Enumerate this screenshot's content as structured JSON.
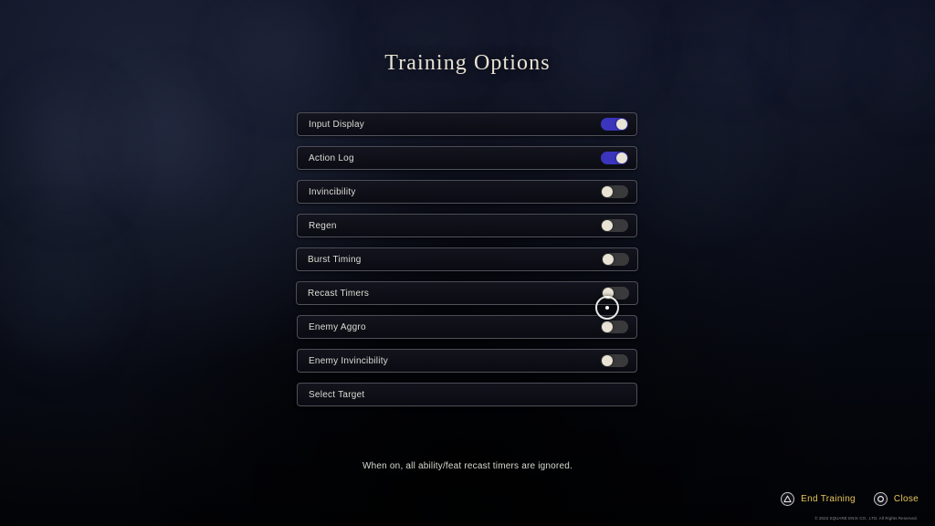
{
  "screen": {
    "title": "Training Options",
    "description": "When on, all ability/feat recast timers are ignored.",
    "copyright": "© 2023 SQUARE ENIX CO., LTD. All Rights Reserved."
  },
  "colors": {
    "toggle_on": "#3b35bd",
    "toggle_off": "#3a3a3c",
    "knob": "#e8e3d4",
    "title_text": "#e9e3d4",
    "label_text": "#ddddd6",
    "prompt_text": "#e8c65c",
    "row_border": "#a8aab6"
  },
  "options": [
    {
      "label": "Input Display",
      "has_toggle": true,
      "state": "on",
      "selected": false
    },
    {
      "label": "Action Log",
      "has_toggle": true,
      "state": "on",
      "selected": false
    },
    {
      "label": "Invincibility",
      "has_toggle": true,
      "state": "off",
      "selected": false
    },
    {
      "label": "Regen",
      "has_toggle": true,
      "state": "off",
      "selected": false
    },
    {
      "label": "Burst Timing",
      "has_toggle": true,
      "state": "off",
      "selected": true
    },
    {
      "label": "Recast Timers",
      "has_toggle": true,
      "state": "off",
      "selected": true
    },
    {
      "label": "Enemy Aggro",
      "has_toggle": true,
      "state": "off",
      "selected": false
    },
    {
      "label": "Enemy Invincibility",
      "has_toggle": true,
      "state": "off",
      "selected": false
    },
    {
      "label": "Select Target",
      "has_toggle": false,
      "state": "",
      "selected": false
    }
  ],
  "footer": {
    "prompts": [
      {
        "icon": "playstation-triangle-icon",
        "label": "End Training"
      },
      {
        "icon": "playstation-circle-icon",
        "label": "Close"
      }
    ]
  }
}
